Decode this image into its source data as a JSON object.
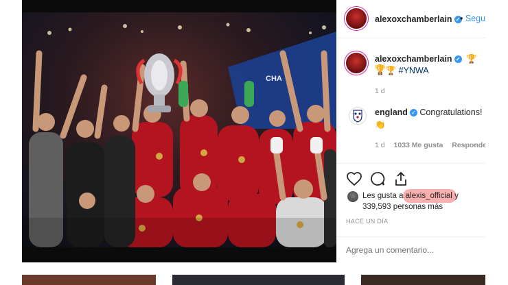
{
  "post": {
    "author": "alexoxchamberlain",
    "follow_label": "Seguir",
    "caption_author": "alexoxchamberlain",
    "caption_trophies": "🏆🏆",
    "caption_trophies_line2": "🏆🏆",
    "caption_hashtag": "#YNWA",
    "caption_time": "1 d",
    "photo_banner_text": "CHA"
  },
  "comment": {
    "author": "england",
    "text": "Congratulations!",
    "emoji": "👏",
    "emoji_line2": "👏",
    "time": "1 d",
    "likes": "1033 Me gusta",
    "reply_label": "Responder"
  },
  "likes": {
    "prefix": "Les gusta a",
    "user": "alexis_official",
    "suffix_y": "y",
    "count_line": "339,593 personas más"
  },
  "timestamp": "HACE UN DÍA",
  "comment_input": {
    "placeholder": "Agrega un comentario..."
  },
  "colors": {
    "accent_blue": "#3897f0",
    "liverpool_red": "#c8102e",
    "highlight": "#f06e6e"
  },
  "icons": [
    "heart-icon",
    "comment-icon",
    "share-icon",
    "verified-icon"
  ]
}
